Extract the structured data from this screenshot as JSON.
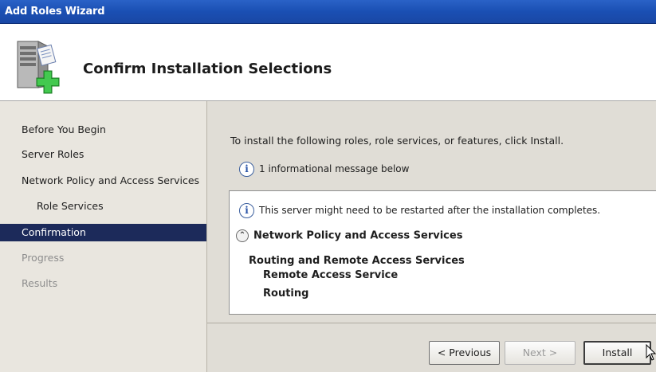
{
  "window": {
    "title": "Add Roles Wizard"
  },
  "header": {
    "title": "Confirm Installation Selections",
    "icon": "server-add-icon"
  },
  "sidebar": {
    "items": [
      {
        "label": "Before You Begin",
        "state": "normal"
      },
      {
        "label": "Server Roles",
        "state": "normal"
      },
      {
        "label": "Network Policy and Access Services",
        "state": "normal"
      },
      {
        "label": "Role Services",
        "state": "normal",
        "indent": true
      },
      {
        "label": "Confirmation",
        "state": "selected"
      },
      {
        "label": "Progress",
        "state": "disabled"
      },
      {
        "label": "Results",
        "state": "disabled"
      }
    ]
  },
  "main": {
    "intro": "To install the following roles, role services, or features, click Install.",
    "info_count": "1 informational message below",
    "summary": {
      "restart_message": "This server might need to be restarted after the installation completes.",
      "section_title": "Network Policy and Access Services",
      "role_title": "Routing and Remote Access Services",
      "role_services": [
        "Remote Access Service",
        "Routing"
      ]
    }
  },
  "buttons": {
    "previous": "< Previous",
    "next": "Next >",
    "install": "Install"
  },
  "colors": {
    "title_bar": "#1a4fb3",
    "selected_nav": "#1c2a5a",
    "info_icon": "#2b55a8"
  }
}
